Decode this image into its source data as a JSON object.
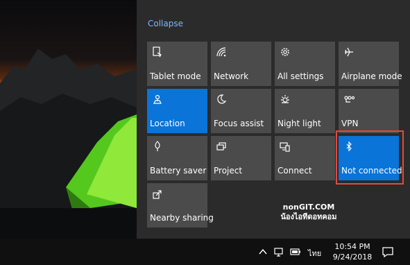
{
  "action_center": {
    "collapse_label": "Collapse",
    "tiles": [
      {
        "label": "Tablet mode",
        "icon": "tablet-mode-icon",
        "active": false
      },
      {
        "label": "Network",
        "icon": "network-icon",
        "active": false
      },
      {
        "label": "All settings",
        "icon": "gear-icon",
        "active": false
      },
      {
        "label": "Airplane mode",
        "icon": "airplane-icon",
        "active": false
      },
      {
        "label": "Location",
        "icon": "location-icon",
        "active": true
      },
      {
        "label": "Focus assist",
        "icon": "moon-icon",
        "active": false
      },
      {
        "label": "Night light",
        "icon": "night-light-icon",
        "active": false
      },
      {
        "label": "VPN",
        "icon": "vpn-icon",
        "active": false
      },
      {
        "label": "Battery saver",
        "icon": "battery-saver-icon",
        "active": false
      },
      {
        "label": "Project",
        "icon": "project-icon",
        "active": false
      },
      {
        "label": "Connect",
        "icon": "connect-icon",
        "active": false
      },
      {
        "label": "Not connected",
        "icon": "bluetooth-icon",
        "active": true
      },
      {
        "label": "Nearby sharing",
        "icon": "nearby-sharing-icon",
        "active": false
      }
    ],
    "active_color": "#0a74d8",
    "tile_color": "#4b4b4b",
    "highlight_color": "#e24b3b"
  },
  "watermark": {
    "line1": "nonGIT.COM",
    "line2": "น้องไอทีดอทคอม"
  },
  "taskbar": {
    "language": "ไทย",
    "time": "10:54 PM",
    "date": "9/24/2018",
    "tray_icons": [
      "chevron-up-icon",
      "network-tray-icon",
      "battery-tray-icon",
      "volume-icon"
    ]
  }
}
